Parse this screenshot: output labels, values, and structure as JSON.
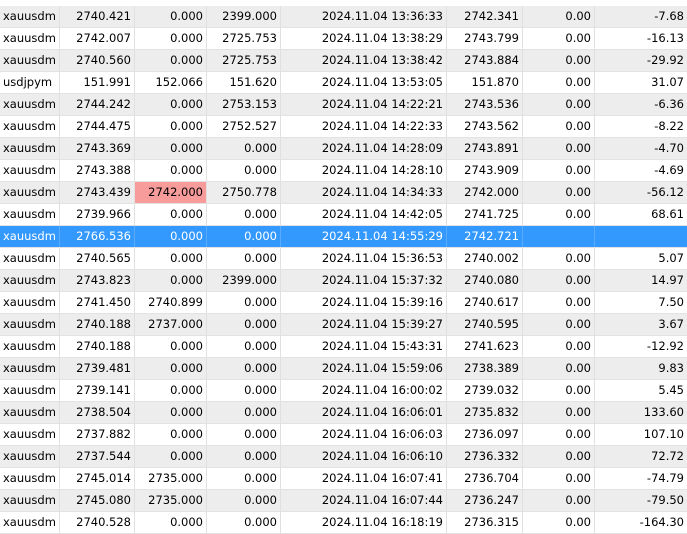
{
  "colors": {
    "selected_row": "#3399ff",
    "stripe_row": "#ededed",
    "highlight_cell": "#f79b9b"
  },
  "trades": [
    {
      "symbol": "xauusdm",
      "open_price": "2740.421",
      "sl": "0.000",
      "tp": "2399.000",
      "close_time": "2024.11.04 13:36:33",
      "close_price": "2742.341",
      "swap": "0.00",
      "profit": "-7.68"
    },
    {
      "symbol": "xauusdm",
      "open_price": "2742.007",
      "sl": "0.000",
      "tp": "2725.753",
      "close_time": "2024.11.04 13:38:29",
      "close_price": "2743.799",
      "swap": "0.00",
      "profit": "-16.13"
    },
    {
      "symbol": "xauusdm",
      "open_price": "2740.560",
      "sl": "0.000",
      "tp": "2725.753",
      "close_time": "2024.11.04 13:38:42",
      "close_price": "2743.884",
      "swap": "0.00",
      "profit": "-29.92"
    },
    {
      "symbol": "usdjpym",
      "open_price": "151.991",
      "sl": "152.066",
      "tp": "151.620",
      "close_time": "2024.11.04 13:53:05",
      "close_price": "151.870",
      "swap": "0.00",
      "profit": "31.07"
    },
    {
      "symbol": "xauusdm",
      "open_price": "2744.242",
      "sl": "0.000",
      "tp": "2753.153",
      "close_time": "2024.11.04 14:22:21",
      "close_price": "2743.536",
      "swap": "0.00",
      "profit": "-6.36"
    },
    {
      "symbol": "xauusdm",
      "open_price": "2744.475",
      "sl": "0.000",
      "tp": "2752.527",
      "close_time": "2024.11.04 14:22:33",
      "close_price": "2743.562",
      "swap": "0.00",
      "profit": "-8.22"
    },
    {
      "symbol": "xauusdm",
      "open_price": "2743.369",
      "sl": "0.000",
      "tp": "0.000",
      "close_time": "2024.11.04 14:28:09",
      "close_price": "2743.891",
      "swap": "0.00",
      "profit": "-4.70"
    },
    {
      "symbol": "xauusdm",
      "open_price": "2743.388",
      "sl": "0.000",
      "tp": "0.000",
      "close_time": "2024.11.04 14:28:10",
      "close_price": "2743.909",
      "swap": "0.00",
      "profit": "-4.69"
    },
    {
      "symbol": "xauusdm",
      "open_price": "2743.439",
      "sl": "2742.000",
      "tp": "2750.778",
      "close_time": "2024.11.04 14:34:33",
      "close_price": "2742.000",
      "swap": "0.00",
      "profit": "-56.12"
    },
    {
      "symbol": "xauusdm",
      "open_price": "2739.966",
      "sl": "0.000",
      "tp": "0.000",
      "close_time": "2024.11.04 14:42:05",
      "close_price": "2741.725",
      "swap": "0.00",
      "profit": "68.61"
    },
    {
      "symbol": "xauusdm",
      "open_price": "2766.536",
      "sl": "0.000",
      "tp": "0.000",
      "close_time": "2024.11.04 14:55:29",
      "close_price": "2742.721",
      "swap": "",
      "profit": ""
    },
    {
      "symbol": "xauusdm",
      "open_price": "2740.565",
      "sl": "0.000",
      "tp": "0.000",
      "close_time": "2024.11.04 15:36:53",
      "close_price": "2740.002",
      "swap": "0.00",
      "profit": "5.07"
    },
    {
      "symbol": "xauusdm",
      "open_price": "2743.823",
      "sl": "0.000",
      "tp": "2399.000",
      "close_time": "2024.11.04 15:37:32",
      "close_price": "2740.080",
      "swap": "0.00",
      "profit": "14.97"
    },
    {
      "symbol": "xauusdm",
      "open_price": "2741.450",
      "sl": "2740.899",
      "tp": "0.000",
      "close_time": "2024.11.04 15:39:16",
      "close_price": "2740.617",
      "swap": "0.00",
      "profit": "7.50"
    },
    {
      "symbol": "xauusdm",
      "open_price": "2740.188",
      "sl": "2737.000",
      "tp": "0.000",
      "close_time": "2024.11.04 15:39:27",
      "close_price": "2740.595",
      "swap": "0.00",
      "profit": "3.67"
    },
    {
      "symbol": "xauusdm",
      "open_price": "2740.188",
      "sl": "0.000",
      "tp": "0.000",
      "close_time": "2024.11.04 15:43:31",
      "close_price": "2741.623",
      "swap": "0.00",
      "profit": "-12.92"
    },
    {
      "symbol": "xauusdm",
      "open_price": "2739.481",
      "sl": "0.000",
      "tp": "0.000",
      "close_time": "2024.11.04 15:59:06",
      "close_price": "2738.389",
      "swap": "0.00",
      "profit": "9.83"
    },
    {
      "symbol": "xauusdm",
      "open_price": "2739.141",
      "sl": "0.000",
      "tp": "0.000",
      "close_time": "2024.11.04 16:00:02",
      "close_price": "2739.032",
      "swap": "0.00",
      "profit": "5.45"
    },
    {
      "symbol": "xauusdm",
      "open_price": "2738.504",
      "sl": "0.000",
      "tp": "0.000",
      "close_time": "2024.11.04 16:06:01",
      "close_price": "2735.832",
      "swap": "0.00",
      "profit": "133.60"
    },
    {
      "symbol": "xauusdm",
      "open_price": "2737.882",
      "sl": "0.000",
      "tp": "0.000",
      "close_time": "2024.11.04 16:06:03",
      "close_price": "2736.097",
      "swap": "0.00",
      "profit": "107.10"
    },
    {
      "symbol": "xauusdm",
      "open_price": "2737.544",
      "sl": "0.000",
      "tp": "0.000",
      "close_time": "2024.11.04 16:06:10",
      "close_price": "2736.332",
      "swap": "0.00",
      "profit": "72.72"
    },
    {
      "symbol": "xauusdm",
      "open_price": "2745.014",
      "sl": "2735.000",
      "tp": "0.000",
      "close_time": "2024.11.04 16:07:41",
      "close_price": "2736.704",
      "swap": "0.00",
      "profit": "-74.79"
    },
    {
      "symbol": "xauusdm",
      "open_price": "2745.080",
      "sl": "2735.000",
      "tp": "0.000",
      "close_time": "2024.11.04 16:07:44",
      "close_price": "2736.247",
      "swap": "0.00",
      "profit": "-79.50"
    },
    {
      "symbol": "xauusdm",
      "open_price": "2740.528",
      "sl": "0.000",
      "tp": "0.000",
      "close_time": "2024.11.04 16:18:19",
      "close_price": "2736.315",
      "swap": "0.00",
      "profit": "-164.30"
    }
  ]
}
